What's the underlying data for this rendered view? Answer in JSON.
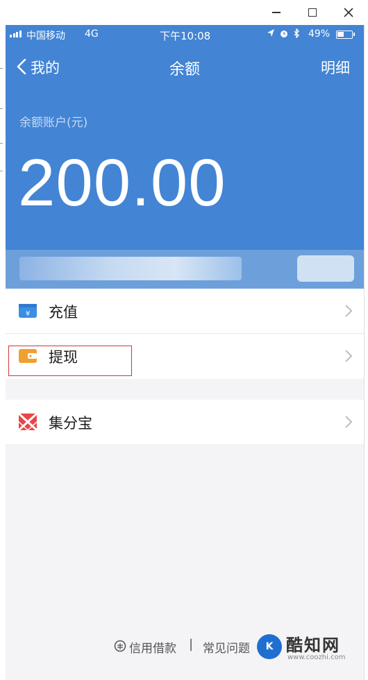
{
  "status_bar": {
    "carrier": "中国移动",
    "network": "4G",
    "time": "下午10:08",
    "battery_percent": "49%",
    "battery_level": 0.49
  },
  "nav": {
    "back_label": "我的",
    "title": "余额",
    "detail_label": "明细"
  },
  "balance": {
    "label": "余额账户(元)",
    "amount": "200.00"
  },
  "menu": {
    "group1": [
      {
        "label": "充值",
        "icon": "recharge-wallet-icon"
      },
      {
        "label": "提现",
        "icon": "withdraw-wallet-icon"
      }
    ],
    "group2": [
      {
        "label": "集分宝",
        "icon": "jifenbao-icon"
      }
    ]
  },
  "footer": {
    "credit_label": "信用借款",
    "separator": "|",
    "faq_label": "常见问题"
  },
  "watermark": {
    "name": "酷知网",
    "url": "www.coozhi.com"
  },
  "colors": {
    "header_blue": "#4384d4",
    "highlight_red": "#d0343a",
    "recharge_icon": "#3a8ee6",
    "withdraw_icon": "#f0a030",
    "jifenbao_icon": "#e8464a"
  }
}
